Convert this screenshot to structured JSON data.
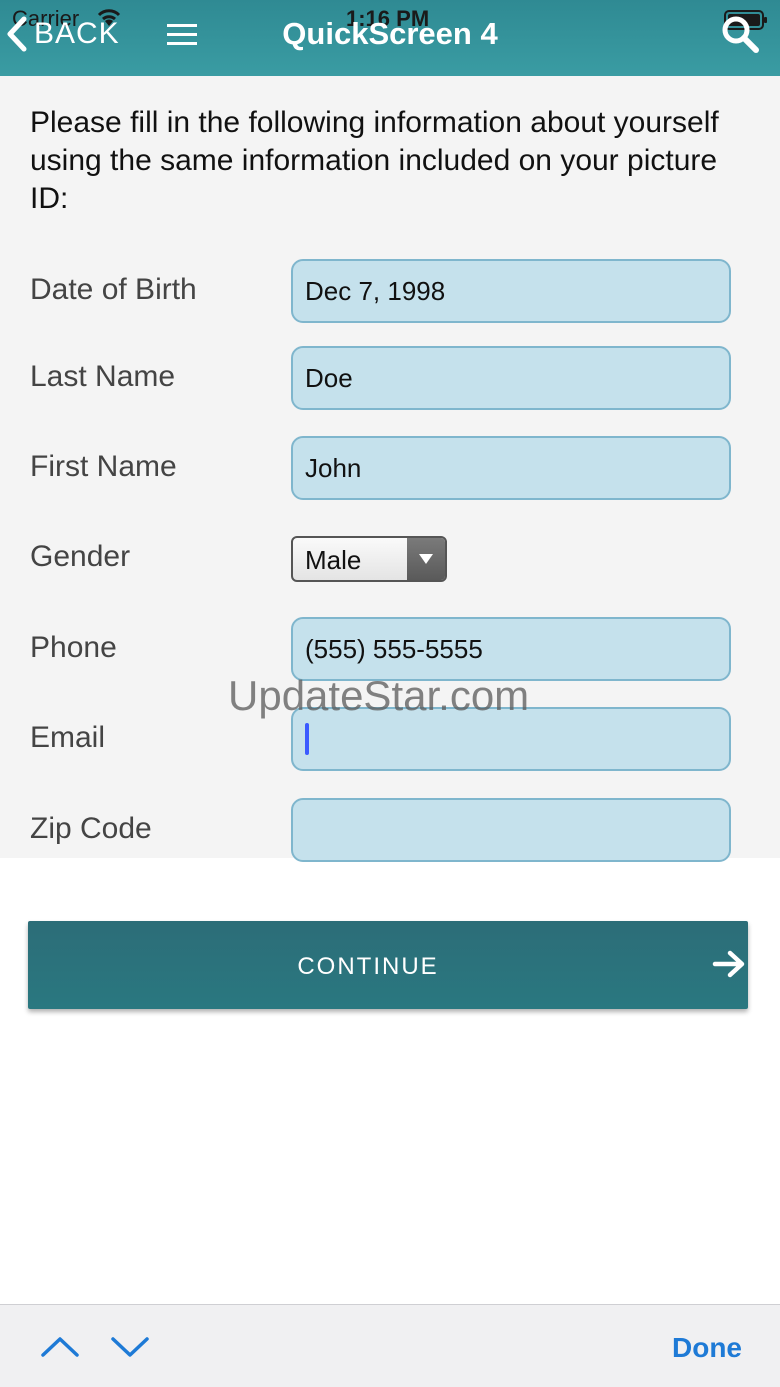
{
  "status_bar": {
    "carrier": "Carrier",
    "time": "1:16 PM"
  },
  "header": {
    "back_label": "BACK",
    "title": "QuickScreen 4"
  },
  "form": {
    "intro": "Please fill in the following information about yourself using the same information included on your picture ID:",
    "fields": [
      {
        "label": "Date of Birth",
        "value": "Dec 7, 1998"
      },
      {
        "label": "Last Name",
        "value": "Doe"
      },
      {
        "label": "First Name",
        "value": "John"
      },
      {
        "label": "Gender",
        "value": "Male"
      },
      {
        "label": "Phone",
        "value": "(555) 555-5555"
      },
      {
        "label": "Email",
        "value": ""
      },
      {
        "label": "Zip Code",
        "value": ""
      }
    ]
  },
  "watermark": "UpdateStar.com",
  "continue_label": "CONTINUE",
  "keyboard_toolbar": {
    "done_label": "Done"
  },
  "colors": {
    "header": "#3a9ca3",
    "continue": "#2c6d78",
    "field_bg": "#c5e1ec",
    "done": "#1e7ad6"
  }
}
